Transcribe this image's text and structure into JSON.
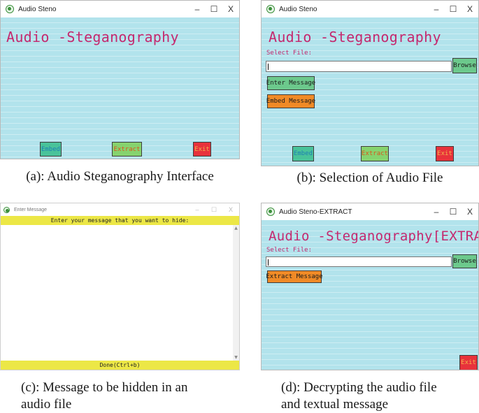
{
  "panel_a": {
    "window_title": "Audio Steno",
    "controls": {
      "minimize": "–",
      "maximize": "☐",
      "close": "X"
    },
    "heading": "Audio -Steganography",
    "buttons": {
      "embed": "Embed",
      "extract": "Extract",
      "exit": "Exit"
    },
    "caption": "(a): Audio Steganography Interface"
  },
  "panel_b": {
    "window_title": "Audio Steno",
    "controls": {
      "minimize": "–",
      "maximize": "☐",
      "close": "X"
    },
    "heading": "Audio -Steganography",
    "select_label": "Select File:",
    "file_value": "",
    "browse": "Browse",
    "enter_message": "Enter Message",
    "embed_message": "Embed Message",
    "buttons": {
      "embed": "Embed",
      "extract": "Extract",
      "exit": "Exit"
    },
    "caption": "(b): Selection of Audio File"
  },
  "panel_c": {
    "window_title": "Enter Message",
    "controls": {
      "minimize": "–",
      "maximize": "☐",
      "close": "X"
    },
    "prompt": "Enter your message that you want to hide:",
    "message_value": "",
    "done": "Done(Ctrl+b)",
    "caption_line1": "(c): Message to be hidden in an",
    "caption_line2": "audio file"
  },
  "panel_d": {
    "window_title": "Audio Steno-EXTRACT",
    "controls": {
      "minimize": "–",
      "maximize": "☐",
      "close": "X"
    },
    "heading": "Audio -Steganography[EXTRACT]",
    "select_label": "Select File:",
    "file_value": "",
    "browse": "Browse",
    "extract_message": "Extract Message",
    "exit": "Exit",
    "caption_line1": "(d): Decrypting the audio file",
    "caption_line2": "and textual message"
  },
  "colors": {
    "window_bg": "#b2e3ec",
    "heading": "#c4286e",
    "embed_btn": "#49c39a",
    "extract_btn": "#86d36e",
    "exit_btn": "#e8323b",
    "embed_message_btn": "#f08a26",
    "message_bar": "#ece746"
  },
  "icons": {
    "app": "shield-app-icon"
  }
}
